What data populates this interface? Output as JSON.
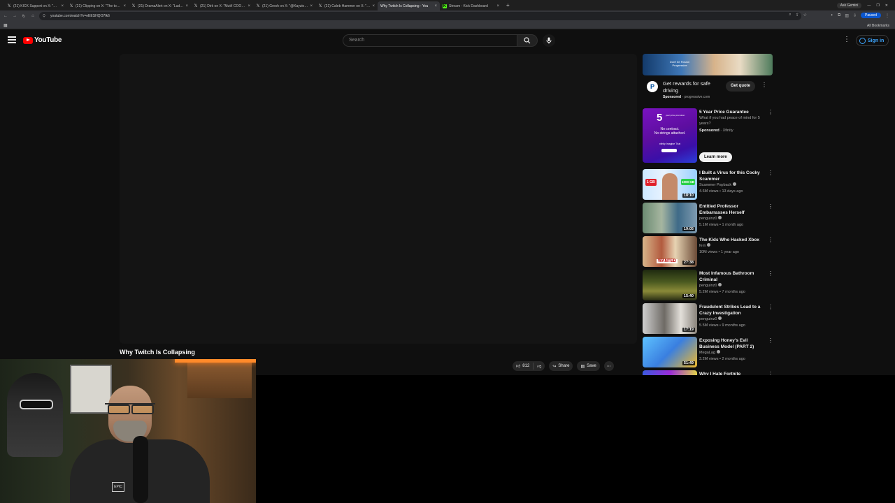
{
  "browser": {
    "tabs": [
      {
        "title": "(21) KICK Support on X: \"@anc",
        "icon": "x-logo-icon",
        "active": false
      },
      {
        "title": "(21) Clipping on X: \"The top 10",
        "icon": "x-logo-icon",
        "active": false
      },
      {
        "title": "(21) DramaAlert on X: \"Ludwig",
        "icon": "x-logo-icon",
        "active": false
      },
      {
        "title": "(21) Dirk on X: \"Mutt! COOKS",
        "icon": "x-logo-icon",
        "active": false
      },
      {
        "title": "(21) Gresh on X: \"@Kayzio_ Ch",
        "icon": "x-logo-icon",
        "active": false
      },
      {
        "title": "(21) Caleb Hammer on X: \"Twit",
        "icon": "x-logo-icon",
        "active": false
      },
      {
        "title": "Why Twitch Is Collapsing - You",
        "icon": "youtube-icon",
        "active": true
      },
      {
        "title": "Stream - Kick Dashboard",
        "icon": "kick-icon",
        "active": false
      }
    ],
    "ask_gemini": "Ask Gemini",
    "url": "youtube.com/watch?v=eEESHQO7Ik6",
    "profile_status": "Paused",
    "all_bookmarks": "All Bookmarks"
  },
  "header": {
    "logo_text": "YouTube",
    "search_placeholder": "Search",
    "signin_label": "Sign in"
  },
  "video": {
    "title": "Why Twitch Is Collapsing",
    "likes": "812",
    "share_label": "Share",
    "save_label": "Save"
  },
  "ad": {
    "banner_text": "Don't be Rosion Progressive",
    "logo_letter": "P",
    "title": "Get rewards for safe driving",
    "sponsored": "Sponsored",
    "domain": "progressive.com",
    "cta": "Get quote"
  },
  "promo": {
    "thumb_number": "5",
    "thumb_small": "year price promotion",
    "thumb_line1": "No contract.",
    "thumb_line2": "No strings attached.",
    "thumb_brand": "xfinity Imagine That",
    "title": "5 Year Price Guarantee",
    "description": "What if you had peace of mind for 5 years?",
    "sponsored": "Sponsored",
    "advertiser": "Xfinity",
    "cta": "Learn more"
  },
  "recommendations": [
    {
      "title": "I Built a Virus for this Cocky Scammer",
      "channel": "Scammer Payback",
      "verified": true,
      "views": "4.6M views",
      "age": "13 days ago",
      "duration": "18:10"
    },
    {
      "title": "Entitled Professor Embarrasses Herself",
      "channel": "penguinz0",
      "verified": true,
      "views": "5.1M views",
      "age": "1 month ago",
      "duration": "19:05"
    },
    {
      "title": "The Kids Who Hacked Xbox",
      "channel": "fern",
      "verified": true,
      "views": "10M views",
      "age": "1 year ago",
      "duration": "27:38"
    },
    {
      "title": "Most Infamous Bathroom Criminal",
      "channel": "penguinz0",
      "verified": true,
      "views": "5.2M views",
      "age": "7 months ago",
      "duration": "15:40"
    },
    {
      "title": "Fraudulent Strikes Lead to a Crazy Investigation",
      "channel": "penguinz0",
      "verified": true,
      "views": "5.5M views",
      "age": "9 months ago",
      "duration": "17:19"
    },
    {
      "title": "Exposing Honey's Evil Business Model (PART 2)",
      "channel": "MegaLag",
      "verified": true,
      "views": "3.2M views",
      "age": "2 months ago",
      "duration": "51:49"
    },
    {
      "title": "Why I Hate Fortnite",
      "channel": "",
      "verified": false,
      "views": "",
      "age": "",
      "duration": ""
    }
  ],
  "thumb_texts": {
    "gb1": "1 GB",
    "gb2": "1000 GB",
    "wanted": "WANTED"
  },
  "webcam": {
    "shirt_logo": "EPIC"
  }
}
